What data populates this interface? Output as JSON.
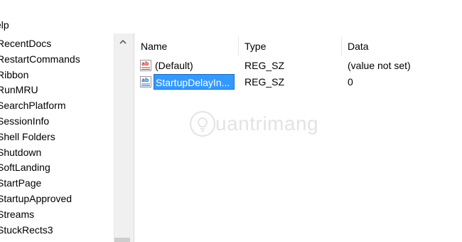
{
  "menubar": {
    "help_label": "elp"
  },
  "tree": {
    "items": [
      "RecentDocs",
      "RestartCommands",
      "Ribbon",
      "RunMRU",
      "SearchPlatform",
      "SessionInfo",
      "Shell Folders",
      "Shutdown",
      "SoftLanding",
      "StartPage",
      "StartupApproved",
      "Streams",
      "StuckRects3"
    ]
  },
  "list": {
    "columns": {
      "name": "Name",
      "type": "Type",
      "data": "Data"
    },
    "rows": [
      {
        "name": "(Default)",
        "type": "REG_SZ",
        "data": "(value not set)",
        "icon": "string-value-icon",
        "selected": false
      },
      {
        "name": "StartupDelayIn...",
        "type": "REG_SZ",
        "data": "0",
        "icon": "string-value-icon",
        "selected": true
      }
    ]
  },
  "watermark": {
    "text": "uantrimang",
    "icon": "lightbulb-logo-icon"
  },
  "colors": {
    "selection": "#3399ff",
    "icon_red": "#d32f2f",
    "icon_blue": "#1e6fc7",
    "watermark": "#e3e3e3"
  }
}
